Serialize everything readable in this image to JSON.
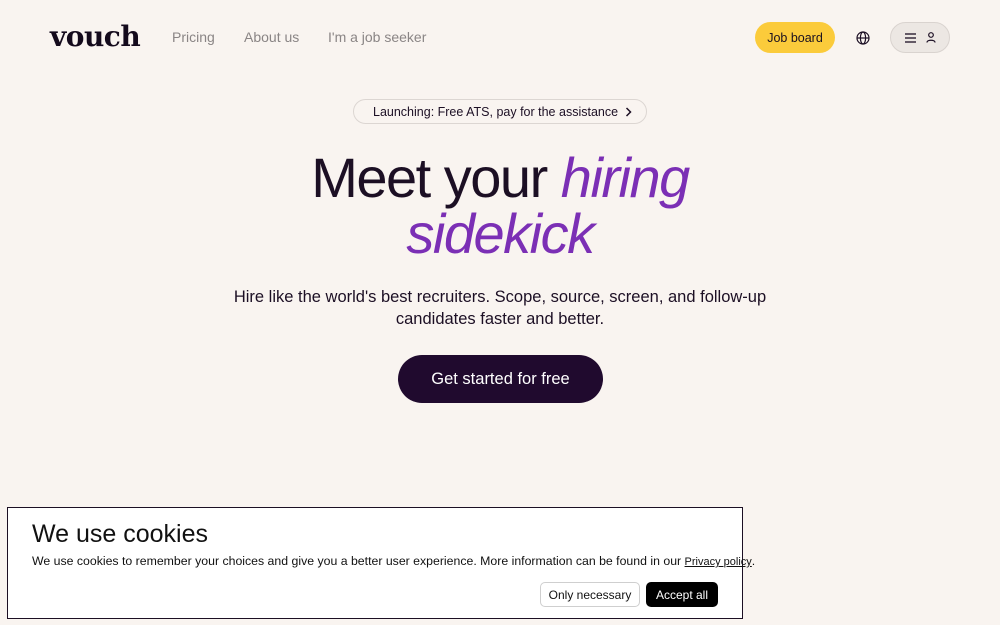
{
  "header": {
    "logo": "vouch",
    "nav": [
      {
        "label": "Pricing"
      },
      {
        "label": "About us"
      },
      {
        "label": "I'm a job seeker"
      }
    ],
    "job_board_label": "Job board",
    "icons": {
      "language": "globe-icon",
      "menu": "hamburger-icon",
      "account": "user-icon"
    }
  },
  "announcement": {
    "text": "Launching: Free ATS, pay for the assistance",
    "icon": "sparkle-icon"
  },
  "hero": {
    "title_plain": "Meet your",
    "title_accent_1": "hiring",
    "title_accent_2": "sidekick",
    "subtitle_line1": "Hire like the world's best recruiters. Scope, source, screen, and follow-up",
    "subtitle_line2": "candidates faster and better.",
    "cta_label": "Get started for free"
  },
  "cookie_banner": {
    "title": "We use cookies",
    "text": "We use cookies to remember your choices and give you a better user experience. More information can be found in our ",
    "link_label": "Privacy policy",
    "text_end": ".",
    "only_necessary_label": "Only necessary",
    "accept_all_label": "Accept all"
  },
  "colors": {
    "background": "#f9f4f0",
    "accent_purple": "#7b2fb5",
    "cta_dark": "#200a2e",
    "job_board_yellow": "#fbcb3b"
  }
}
